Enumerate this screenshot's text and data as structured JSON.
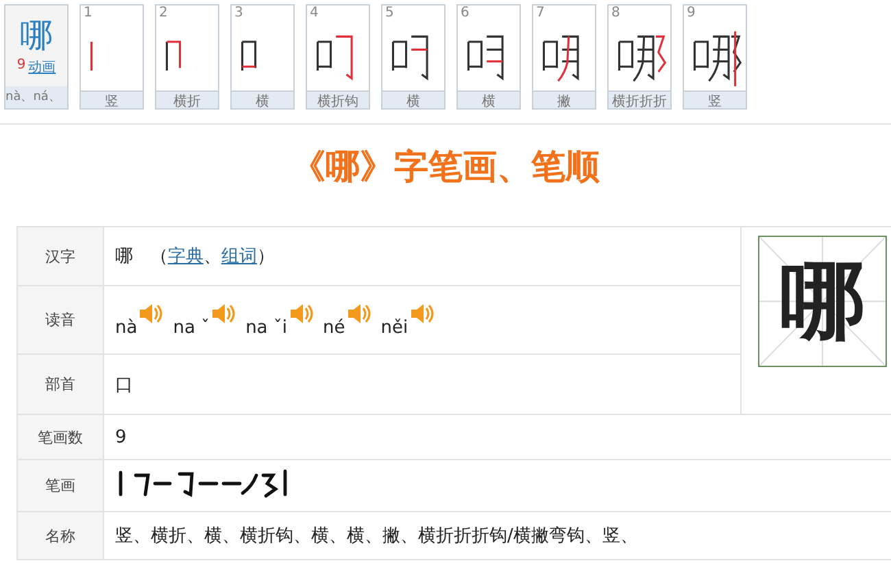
{
  "stroke_order": {
    "character": "哪",
    "count": "9",
    "animation_link": "动画",
    "pinyin": "nà、ná、",
    "steps": [
      {
        "number": "1",
        "name": "竖"
      },
      {
        "number": "2",
        "name": "横折"
      },
      {
        "number": "3",
        "name": "横"
      },
      {
        "number": "4",
        "name": "横折钩"
      },
      {
        "number": "5",
        "name": "横"
      },
      {
        "number": "6",
        "name": "横"
      },
      {
        "number": "7",
        "name": "撇"
      },
      {
        "number": "8",
        "name": "横折折折"
      },
      {
        "number": "9",
        "name": "竖"
      }
    ]
  },
  "title": "《哪》字笔画、笔顺",
  "table": {
    "large_character": "哪",
    "rows": [
      {
        "kind": "hanzi",
        "label": "汉字",
        "value": "哪",
        "open": "（",
        "links": [
          "字典",
          "组词"
        ],
        "separator": "、",
        "close": "）"
      },
      {
        "kind": "readings",
        "label": "读音",
        "readings": [
          "nà",
          "na ˇ",
          "na ˇi",
          "né",
          "něi"
        ]
      },
      {
        "kind": "text",
        "label": "部首",
        "value": "口"
      },
      {
        "kind": "text",
        "label": "笔画数",
        "value": "9"
      },
      {
        "kind": "strokes",
        "label": "笔画"
      },
      {
        "kind": "text",
        "label": "名称",
        "value": "竖、横折、横、横折钩、横、横、撇、横折折折钩/横撇弯钩、竖、"
      }
    ]
  }
}
